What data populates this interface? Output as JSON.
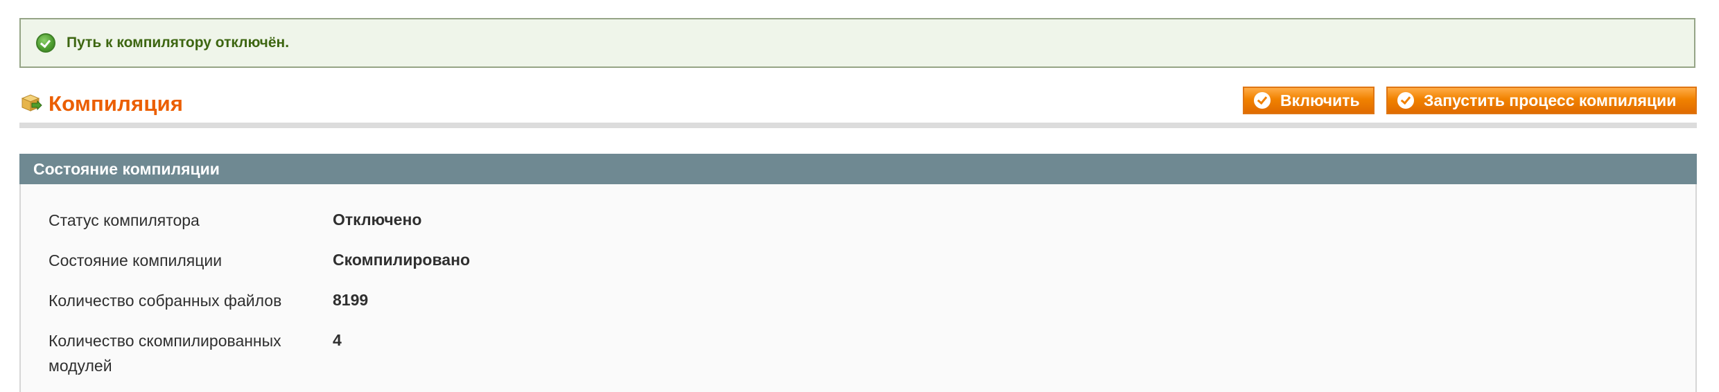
{
  "message": {
    "type": "success",
    "icon": "success-check-icon",
    "text": "Путь к компилятору отключён."
  },
  "header": {
    "icon": "compilation-box-icon",
    "title": "Компиляция",
    "buttons": {
      "enable_label": "Включить",
      "run_label": "Запустить процесс компиляции"
    }
  },
  "section": {
    "title": "Состояние компиляции",
    "rows": [
      {
        "label": "Статус компилятора",
        "value": "Отключено"
      },
      {
        "label": "Состояние компиляции",
        "value": "Скомпилировано"
      },
      {
        "label": "Количество собранных файлов",
        "value": "8199"
      },
      {
        "label": "Количество скомпилированных модулей",
        "value": "4"
      }
    ]
  },
  "colors": {
    "accent_orange": "#eb5e00",
    "button_orange": "#f18200",
    "section_header": "#6f8992",
    "success_bg": "#eff5ea",
    "success_text": "#3d6611"
  }
}
